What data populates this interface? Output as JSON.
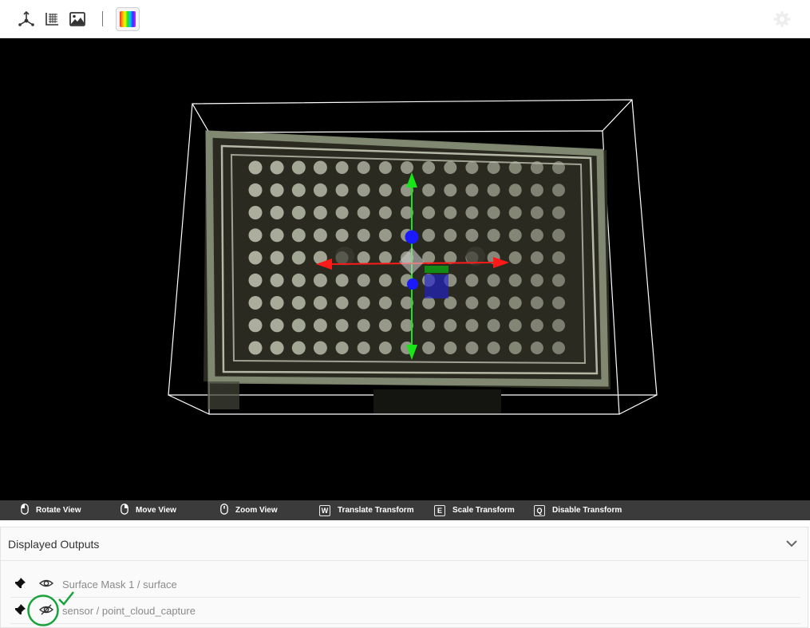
{
  "toolbar": {
    "icons": [
      "axes-3d-icon",
      "grid-scene-icon",
      "image-icon",
      "color-palette-icon",
      "settings-gear-icon"
    ]
  },
  "viewport": {
    "description_icons": [
      "point-cloud",
      "bounding-box",
      "transform-gizmo"
    ],
    "gizmo_colors": {
      "x": "#ff1a1a",
      "y": "#19e619",
      "z": "#1a1aff"
    }
  },
  "hints": [
    {
      "icon": "mouse-left-icon",
      "label": "Rotate View"
    },
    {
      "icon": "mouse-right-icon",
      "label": "Move View"
    },
    {
      "icon": "mouse-wheel-icon",
      "label": "Zoom View"
    },
    {
      "key": "W",
      "label": "Translate Transform"
    },
    {
      "key": "E",
      "label": "Scale Transform"
    },
    {
      "key": "Q",
      "label": "Disable Transform"
    }
  ],
  "outputs": {
    "title": "Displayed Outputs",
    "items": [
      {
        "label": "Surface Mask 1 / surface",
        "visible": true
      },
      {
        "label": "sensor / point_cloud_capture",
        "visible": false
      }
    ]
  },
  "annotation_colors": {
    "highlight": "#1aa33c"
  }
}
